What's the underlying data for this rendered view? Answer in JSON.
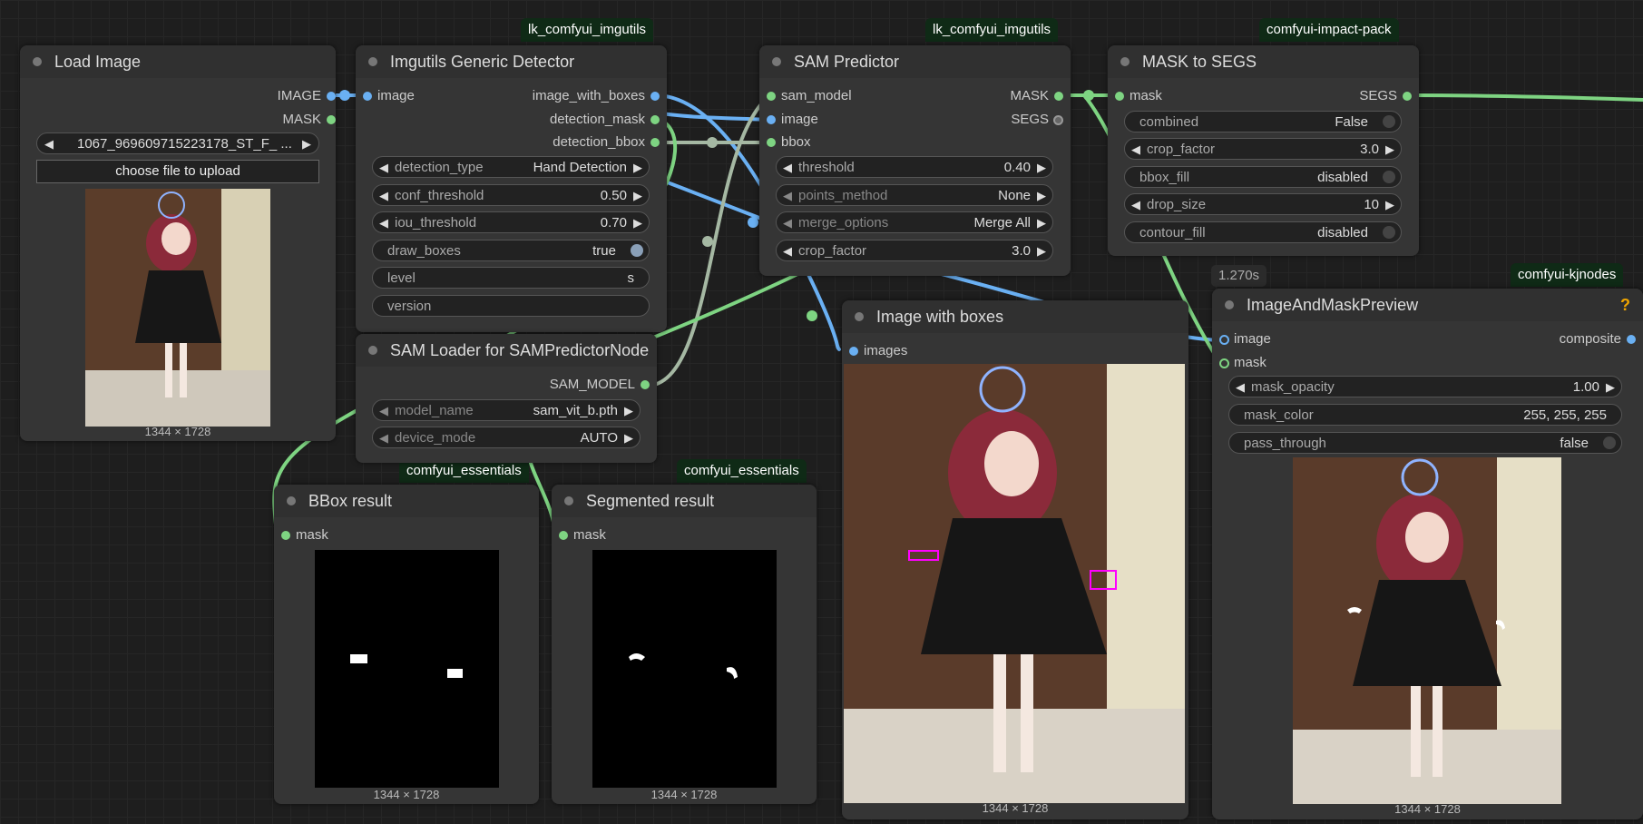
{
  "badges": {
    "imgutils_1": "lk_comfyui_imgutils",
    "imgutils_2": "lk_comfyui_imgutils",
    "impact": "comfyui-impact-pack",
    "kjnodes": "comfyui-kjnodes",
    "essentials_1": "comfyui_essentials",
    "essentials_2": "comfyui_essentials",
    "time": "1.270s"
  },
  "load_image": {
    "title": "Load Image",
    "out_image": "IMAGE",
    "out_mask": "MASK",
    "file": "1067_969609715223178_ST_F_ ...",
    "upload": "choose file to upload",
    "dims": "1344 × 1728"
  },
  "detector": {
    "title": "Imgutils Generic Detector",
    "in_image": "image",
    "out_boxes": "image_with_boxes",
    "out_mask": "detection_mask",
    "out_bbox": "detection_bbox",
    "w_type_l": "detection_type",
    "w_type_v": "Hand Detection",
    "w_conf_l": "conf_threshold",
    "w_conf_v": "0.50",
    "w_iou_l": "iou_threshold",
    "w_iou_v": "0.70",
    "w_draw_l": "draw_boxes",
    "w_draw_v": "true",
    "w_level_l": "level",
    "w_level_v": "s",
    "w_version_l": "version"
  },
  "sam_loader": {
    "title": "SAM Loader for SAMPredictorNode",
    "out": "SAM_MODEL",
    "w_model_l": "model_name",
    "w_model_v": "sam_vit_b.pth",
    "w_device_l": "device_mode",
    "w_device_v": "AUTO"
  },
  "sam_predictor": {
    "title": "SAM Predictor",
    "in_model": "sam_model",
    "in_image": "image",
    "in_bbox": "bbox",
    "out_mask": "MASK",
    "out_segs": "SEGS",
    "w_thr_l": "threshold",
    "w_thr_v": "0.40",
    "w_pts_l": "points_method",
    "w_pts_v": "None",
    "w_merge_l": "merge_options",
    "w_merge_v": "Merge All",
    "w_crop_l": "crop_factor",
    "w_crop_v": "3.0"
  },
  "mask_to_segs": {
    "title": "MASK to SEGS",
    "in_mask": "mask",
    "out_segs": "SEGS",
    "w_comb_l": "combined",
    "w_comb_v": "False",
    "w_crop_l": "crop_factor",
    "w_crop_v": "3.0",
    "w_bbox_l": "bbox_fill",
    "w_bbox_v": "disabled",
    "w_drop_l": "drop_size",
    "w_drop_v": "10",
    "w_cont_l": "contour_fill",
    "w_cont_v": "disabled"
  },
  "bbox_result": {
    "title": "BBox result",
    "in_mask": "mask",
    "dims": "1344 × 1728"
  },
  "seg_result": {
    "title": "Segmented result",
    "in_mask": "mask",
    "dims": "1344 × 1728"
  },
  "image_boxes": {
    "title": "Image with boxes",
    "in_images": "images",
    "dims": "1344 × 1728"
  },
  "preview": {
    "title": "ImageAndMaskPreview",
    "help": "?",
    "in_image": "image",
    "in_mask": "mask",
    "out_composite": "composite",
    "w_op_l": "mask_opacity",
    "w_op_v": "1.00",
    "w_color_l": "mask_color",
    "w_color_v": "255, 255, 255",
    "w_pass_l": "pass_through",
    "w_pass_v": "false",
    "dims": "1344 × 1728"
  },
  "colors": {
    "image_link": "#6ab0f3",
    "mask_link": "#7ed482",
    "model_link": "#a5b8a3",
    "badge_bg": "#0f2a16"
  }
}
